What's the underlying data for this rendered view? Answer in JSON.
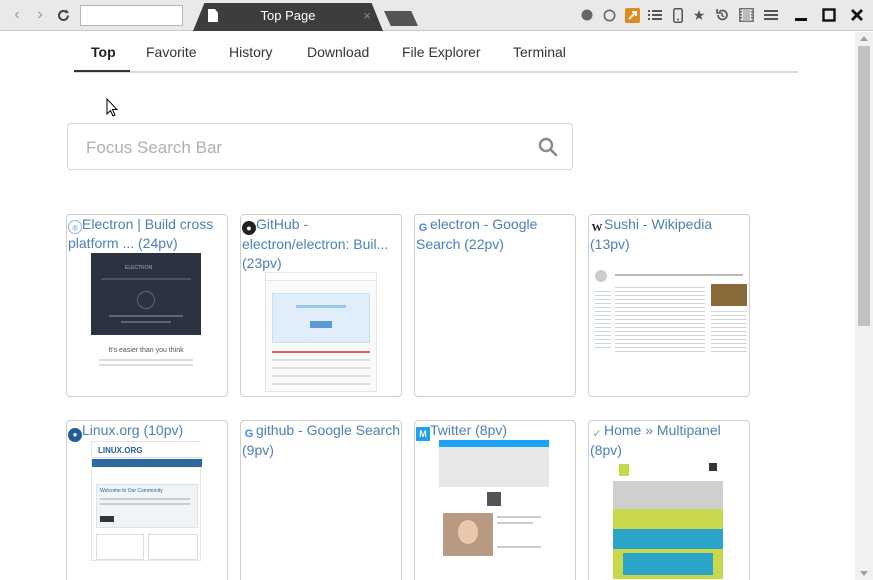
{
  "browser": {
    "url": "",
    "tab_title": "Top Page",
    "tab_close": "×"
  },
  "menu": {
    "items": [
      {
        "label": "Top",
        "active": true
      },
      {
        "label": "Favorite"
      },
      {
        "label": "History"
      },
      {
        "label": "Download"
      },
      {
        "label": "File Explorer"
      },
      {
        "label": "Terminal"
      }
    ]
  },
  "search": {
    "placeholder": "Focus Search Bar",
    "value": ""
  },
  "cards": [
    {
      "title": "Electron | Build cross platform ... (24pv)",
      "favicon": "electron-icon"
    },
    {
      "title": "GitHub - electron/electron: Buil... (23pv)",
      "favicon": "github-icon"
    },
    {
      "title": "electron - Google Search (22pv)",
      "favicon": "google-icon"
    },
    {
      "title": "Sushi - Wikipedia (13pv)",
      "favicon": "wikipedia-icon"
    },
    {
      "title": "Linux.org (10pv)",
      "favicon": "linux-org-icon"
    },
    {
      "title": "github - Google Search (9pv)",
      "favicon": "google-icon"
    },
    {
      "title": "Twitter (8pv)",
      "favicon": "mobile-icon"
    },
    {
      "title": "Home » Multipanel (8pv)",
      "favicon": "multipanel-icon"
    }
  ],
  "thumbnails": {
    "electron_logo": "ELECTRON",
    "electron_tagline": "It's easier than you think",
    "linux_logo": "LINUX.ORG",
    "linux_welcome": "Welcome to Our Community"
  },
  "colors": {
    "link": "#4a7fb8",
    "tab_bg": "#3d3d3d",
    "chrome_bg": "#e9e9e9"
  }
}
